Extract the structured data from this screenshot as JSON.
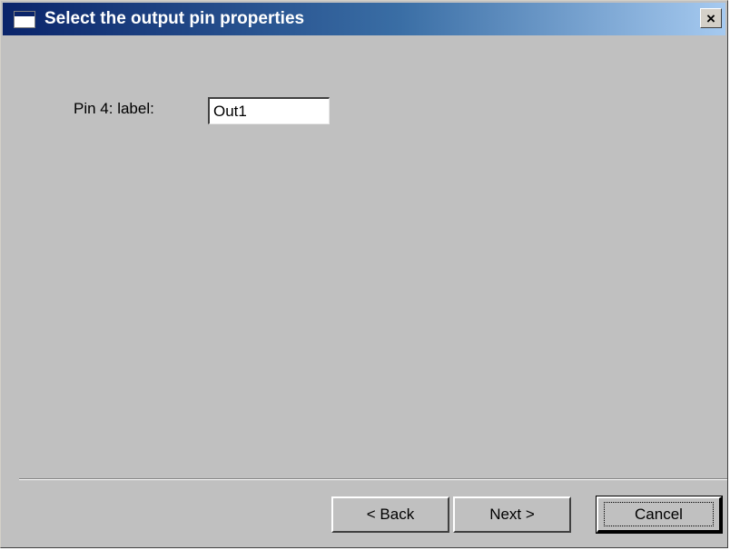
{
  "window": {
    "title": "Select the output pin properties",
    "close_glyph": "×"
  },
  "form": {
    "pin_label": "Pin 4: label:",
    "pin_value": "Out1"
  },
  "buttons": {
    "back_label": "< Back",
    "next_label": "Next >",
    "cancel_label": "Cancel"
  },
  "icons": {
    "window_icon": "window-icon",
    "close_icon": "close-icon"
  },
  "colors": {
    "titlebar_start": "#0a246a",
    "titlebar_end": "#a6caf0",
    "window_bg": "#c0c0c0"
  }
}
